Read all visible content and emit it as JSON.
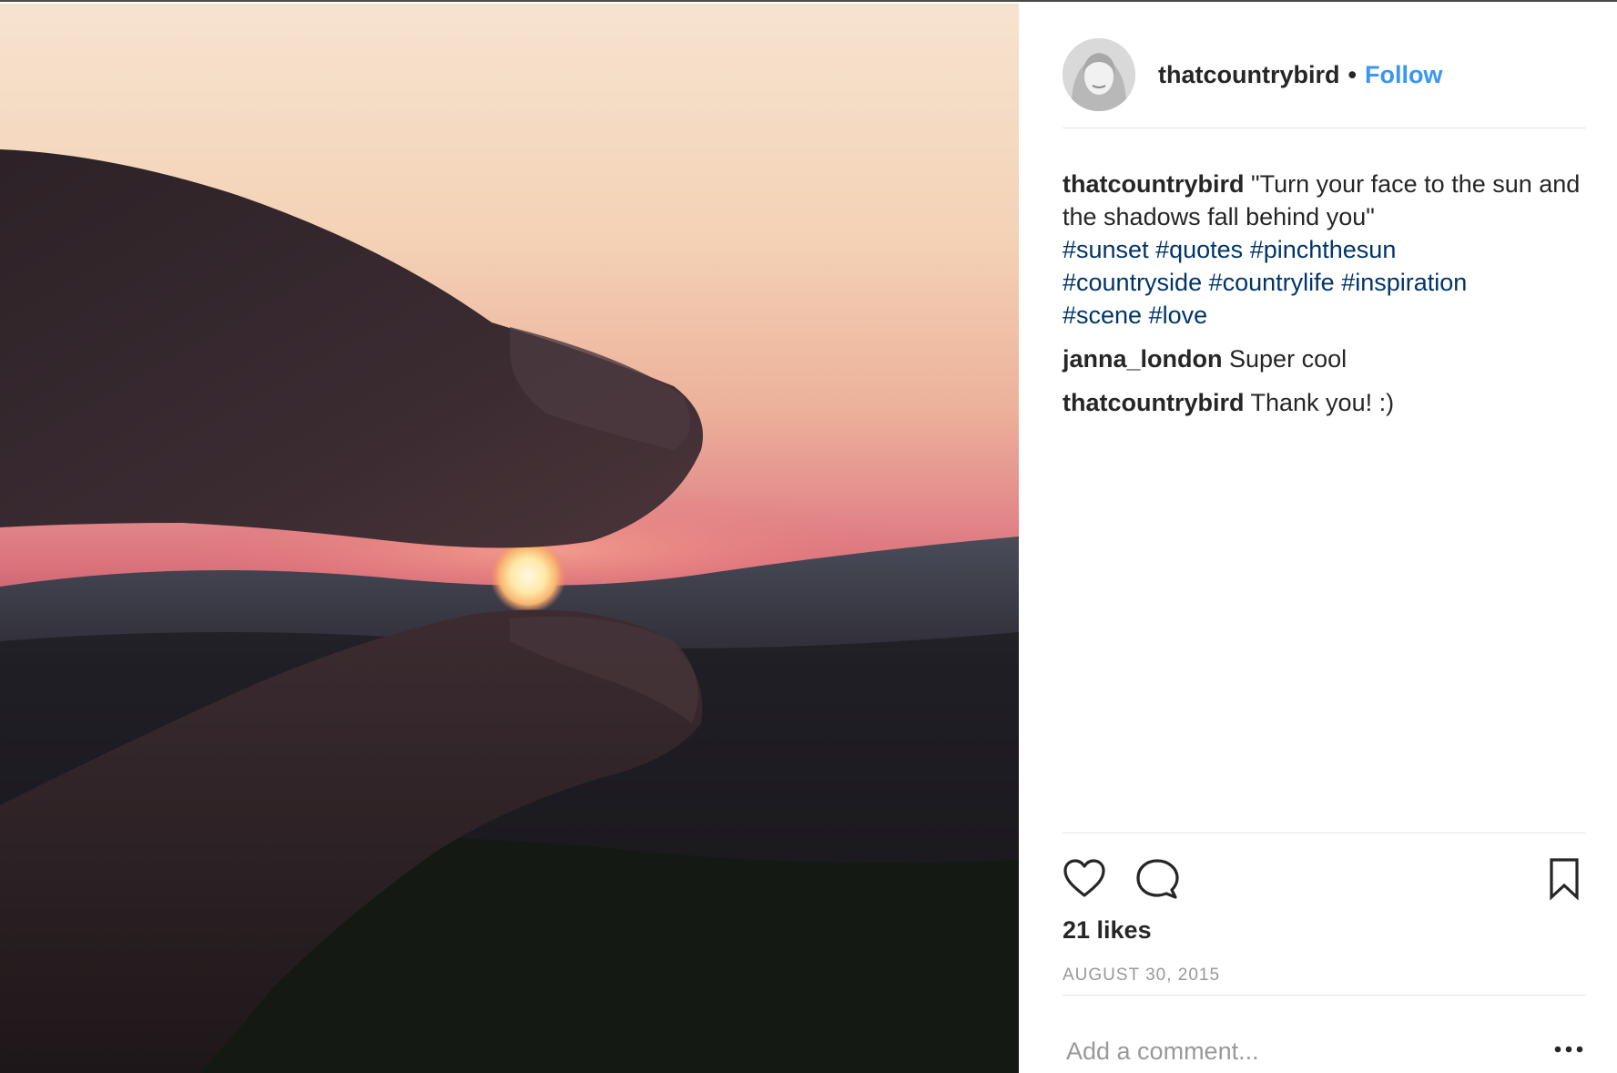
{
  "post": {
    "author": "thatcountrybird",
    "separator": "•",
    "follow_label": "Follow",
    "caption": {
      "username": "thatcountrybird",
      "text": "\"Turn your face to the sun and the shadows fall behind you\"",
      "hashtags": [
        "#sunset",
        "#quotes",
        "#pinchthesun",
        "#countryside",
        "#countrylife",
        "#inspiration",
        "#scene",
        "#love"
      ]
    },
    "comments": [
      {
        "username": "janna_london",
        "text": "Super cool"
      },
      {
        "username": "thatcountrybird",
        "text": "Thank you! :)"
      }
    ],
    "likes": "21 likes",
    "date": "AUGUST 30, 2015",
    "add_comment_placeholder": "Add a comment..."
  },
  "icons": {
    "like": "heart-icon",
    "comment": "comment-bubble-icon",
    "save": "bookmark-icon",
    "more": "more-options-icon"
  },
  "colors": {
    "link": "#003569",
    "follow": "#3897f0",
    "text": "#262626",
    "muted": "#999999",
    "divider": "#e6e6e6"
  }
}
